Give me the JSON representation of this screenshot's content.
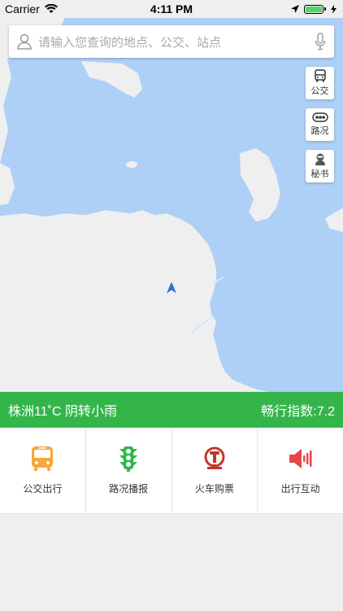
{
  "status_bar": {
    "carrier": "Carrier",
    "time": "4:11 PM"
  },
  "search": {
    "placeholder": "请输入您查询的地点、公交、站点",
    "icons": [
      "user-icon",
      "microphone-icon"
    ]
  },
  "map_buttons": [
    {
      "label": "公交",
      "icon": "bus-icon"
    },
    {
      "label": "路况",
      "icon": "traffic-icon"
    },
    {
      "label": "秘书",
      "icon": "assistant-icon"
    }
  ],
  "weather": {
    "text": "株洲11˚C 阴转小雨",
    "index": "畅行指数:7.2"
  },
  "quick_menu": [
    {
      "label": "公交出行",
      "icon": "bus-front-icon",
      "color": "#f7a63b"
    },
    {
      "label": "路况播报",
      "icon": "traffic-light-icon",
      "color": "#33b54a"
    },
    {
      "label": "火车购票",
      "icon": "railway-logo-icon",
      "color": "#c0392b"
    },
    {
      "label": "出行互动",
      "icon": "speaker-icon",
      "color": "#e8454a"
    }
  ],
  "colors": {
    "water": "#aed0f7",
    "land": "#efefef",
    "accent_green": "#33b54a",
    "location_arrow": "#2d6fd6"
  }
}
